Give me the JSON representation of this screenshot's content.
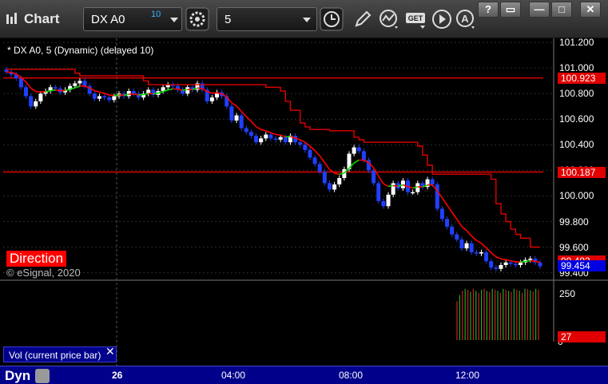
{
  "app": {
    "title": "Chart"
  },
  "toolbar": {
    "symbol": "DX A0",
    "delay": "10",
    "interval": "5",
    "window_buttons": [
      "?",
      "▭",
      "—",
      "□",
      "✕"
    ]
  },
  "chart": {
    "header": "* DX A0, 5 (Dynamic) (delayed 10)",
    "direction_label": "Direction",
    "copyright": "© eSignal, 2020",
    "price_ticks": [
      "101.200",
      "101.000",
      "100.800",
      "100.600",
      "100.400",
      "100.200",
      "100.000",
      "99.800",
      "99.600",
      "99.400"
    ],
    "price_tags": [
      {
        "text": "100.923",
        "color": "#e00000"
      },
      {
        "text": "100.187",
        "color": "#e00000"
      },
      {
        "text": "99.492",
        "color": "#e00000"
      },
      {
        "text": "99.454",
        "color": "#0000e0"
      }
    ],
    "time_labels": [
      "26",
      "04:00",
      "08:00",
      "12:00"
    ]
  },
  "volume": {
    "label": "Vol (current price bar)",
    "close_glyph": "✕",
    "ticks": [
      "250",
      "0"
    ],
    "tag": "27"
  },
  "footer": {
    "dyn_label": "Dyn"
  },
  "colors": {
    "bull": "#ffffff",
    "bear": "#2040ff",
    "ma_red": "#ff0000",
    "ma_green": "#00dd00",
    "axis_bg": "#00008b"
  },
  "chart_data": {
    "type": "candlestick",
    "ylim": [
      99.36,
      101.22
    ],
    "yticks": [
      101.2,
      101.0,
      100.8,
      100.6,
      100.4,
      100.2,
      100.0,
      99.8,
      99.6,
      99.4
    ],
    "reference_lines": [
      100.923,
      100.187
    ],
    "last_price": 99.454,
    "ma_value": 99.492,
    "closes": [
      100.97,
      100.95,
      100.92,
      100.85,
      100.78,
      100.7,
      100.74,
      100.8,
      100.82,
      100.85,
      100.84,
      100.81,
      100.83,
      100.86,
      100.88,
      100.9,
      100.86,
      100.8,
      100.76,
      100.78,
      100.77,
      100.75,
      100.78,
      100.8,
      100.78,
      100.82,
      100.8,
      100.77,
      100.8,
      100.83,
      100.79,
      100.82,
      100.85,
      100.87,
      100.86,
      100.83,
      100.8,
      100.85,
      100.83,
      100.88,
      100.83,
      100.74,
      100.77,
      100.81,
      100.78,
      100.7,
      100.59,
      100.63,
      100.53,
      100.5,
      100.47,
      100.42,
      100.45,
      100.48,
      100.45,
      100.44,
      100.46,
      100.42,
      100.47,
      100.42,
      100.4,
      100.36,
      100.3,
      100.25,
      100.19,
      100.1,
      100.05,
      100.09,
      100.14,
      100.21,
      100.33,
      100.38,
      100.35,
      100.28,
      100.2,
      100.1,
      99.96,
      99.92,
      100.01,
      100.1,
      100.06,
      100.12,
      100.03,
      100.03,
      100.1,
      100.07,
      100.13,
      100.09,
      99.9,
      99.82,
      99.76,
      99.7,
      99.66,
      99.59,
      99.63,
      99.56,
      99.55,
      99.56,
      99.49,
      99.44,
      99.43,
      99.46,
      99.48,
      99.47,
      99.46,
      99.48,
      99.5,
      99.51,
      99.48,
      99.45
    ],
    "volume_ylim": [
      0,
      280
    ],
    "volume": [
      190,
      220,
      240,
      250,
      245,
      235,
      250,
      240,
      230,
      245,
      250,
      240,
      235,
      250,
      245,
      240,
      230,
      250,
      245,
      240,
      235,
      250,
      245,
      240,
      230,
      250,
      248,
      242,
      236,
      250,
      245
    ]
  }
}
